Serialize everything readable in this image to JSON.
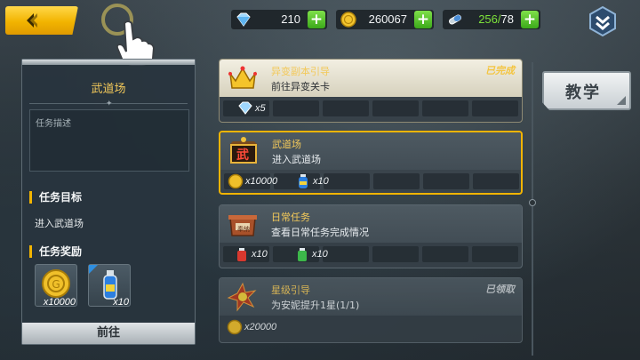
{
  "topbar": {
    "diamonds": "210",
    "gold": "260067",
    "stamina_current": "256",
    "stamina_separator": "/",
    "stamina_max": "78",
    "plus_symbol": "+"
  },
  "left_panel": {
    "title": "武道场",
    "description_label": "任务描述",
    "goal_heading": "任务目标",
    "goal_text": "进入武道场",
    "reward_heading": "任务奖励",
    "rewards": [
      {
        "icon": "gold-coin-icon",
        "amount": "x10000"
      },
      {
        "icon": "exp-potion-icon",
        "amount": "x10"
      }
    ],
    "go_button": "前往"
  },
  "tasks": [
    {
      "title": "异变副本引导",
      "subtitle": "前往异变关卡",
      "status": "已完成",
      "icon": "crown-icon",
      "rewards": [
        {
          "icon": "diamond-icon",
          "amount": "x5"
        }
      ]
    },
    {
      "title": "武道场",
      "subtitle": "进入武道场",
      "status": "",
      "icon": "dojo-sign-icon",
      "icon_text": "武",
      "rewards": [
        {
          "icon": "gold-coin-icon",
          "amount": "x10000"
        },
        {
          "icon": "exp-potion-icon",
          "amount": "x10"
        }
      ]
    },
    {
      "title": "日常任务",
      "subtitle": "查看日常任务完成情况",
      "status": "",
      "icon": "treasure-box-icon",
      "icon_text": "奉納",
      "rewards": [
        {
          "icon": "red-potion-icon",
          "amount": "x10"
        },
        {
          "icon": "green-potion-icon",
          "amount": "x10"
        }
      ]
    },
    {
      "title": "星级引导",
      "subtitle": "为安妮提升1星(1/1)",
      "status": "已领取",
      "icon": "star-burst-icon",
      "rewards": [
        {
          "icon": "gold-coin-icon",
          "amount": "x20000"
        }
      ]
    }
  ],
  "teach_button": "教学",
  "colors": {
    "accent_gold": "#f2b400",
    "title_gold": "#f3c95a",
    "plus_green": "#3ca91a",
    "stamina_green": "#7de23a"
  }
}
